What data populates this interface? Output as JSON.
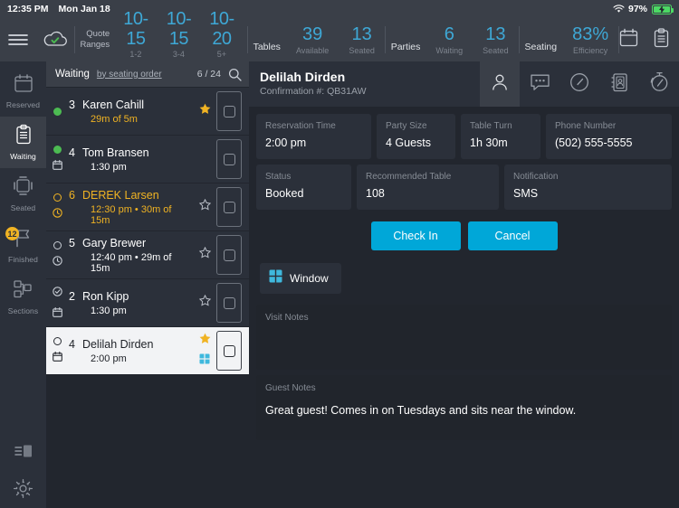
{
  "statusbar": {
    "time": "12:35 PM",
    "date": "Mon Jan 18",
    "battery": "97%",
    "wifi_icon": "wifi-icon",
    "battery_icon": "battery-charging-icon"
  },
  "topbar": {
    "menu_icon": "hamburger-menu-icon",
    "cloud_icon": "cloud-sync-icon",
    "quote": {
      "label_line1": "Quote",
      "label_line2": "Ranges",
      "cells": [
        {
          "value": "10-15",
          "label": "1-2 Parties"
        },
        {
          "value": "10-15",
          "label": "3-4 Parties"
        },
        {
          "value": "10-20",
          "label": "5+ Parties"
        }
      ]
    },
    "groups": [
      {
        "title": "Tables",
        "stats": [
          {
            "value": "39",
            "label": "Available"
          },
          {
            "value": "13",
            "label": "Seated"
          }
        ]
      },
      {
        "title": "Parties",
        "stats": [
          {
            "value": "6",
            "label": "Waiting"
          },
          {
            "value": "13",
            "label": "Seated"
          }
        ]
      },
      {
        "title": "Seating",
        "stats": [
          {
            "value": "83%",
            "label": "Efficiency"
          }
        ]
      }
    ],
    "right_icons": [
      "calendar-icon",
      "clipboard-icon"
    ]
  },
  "sidebar": {
    "items": [
      {
        "label": "Reserved",
        "icon": "calendar-icon",
        "active": false,
        "badge": null
      },
      {
        "label": "Waiting",
        "icon": "clipboard-icon",
        "active": true,
        "badge": null
      },
      {
        "label": "Seated",
        "icon": "table-icon",
        "active": false,
        "badge": null
      },
      {
        "label": "Finished",
        "icon": "flag-icon",
        "active": false,
        "badge": "12"
      },
      {
        "label": "Sections",
        "icon": "sections-icon",
        "active": false,
        "badge": null
      }
    ],
    "bottom_icons": [
      "layout-panel-icon",
      "gear-icon"
    ]
  },
  "list": {
    "title": "Waiting",
    "sort_label": "by seating order",
    "count": "6 / 24",
    "search_icon": "search-icon",
    "rows": [
      {
        "status_icon": "dot-green",
        "party_size": "3",
        "name": "Karen Cahill",
        "detail": "29m of 5m",
        "type_icon": null,
        "star": "star-filled",
        "amber": true,
        "selected": false,
        "window_icon": false
      },
      {
        "status_icon": "dot-green",
        "party_size": "4",
        "name": "Tom Bransen",
        "detail": "1:30 pm",
        "type_icon": "calendar-icon",
        "star": null,
        "amber": false,
        "selected": false,
        "window_icon": false
      },
      {
        "status_icon": "ring-amber",
        "party_size": "6",
        "name": "DEREK Larsen",
        "detail": "12:30 pm  •  30m of 15m",
        "type_icon": "clock-icon",
        "star": "star-outline",
        "amber": true,
        "selected": false,
        "window_icon": false
      },
      {
        "status_icon": "ring-white",
        "party_size": "5",
        "name": "Gary Brewer",
        "detail": "12:40 pm  •  29m of 15m",
        "type_icon": "clock-icon",
        "star": "star-outline",
        "amber": false,
        "selected": false,
        "window_icon": false
      },
      {
        "status_icon": "check-circle",
        "party_size": "2",
        "name": "Ron Kipp",
        "detail": "1:30 pm",
        "type_icon": "calendar-icon",
        "star": "star-outline",
        "amber": false,
        "selected": false,
        "window_icon": false
      },
      {
        "status_icon": "ring-white",
        "party_size": "4",
        "name": "Delilah Dirden",
        "detail": "2:00 pm",
        "type_icon": "calendar-icon",
        "star": "star-filled",
        "amber": false,
        "selected": true,
        "window_icon": true
      }
    ]
  },
  "detail": {
    "name": "Delilah Dirden",
    "confirmation": "Confirmation #: QB31AW",
    "tabs": [
      {
        "icon": "person-icon",
        "active": true
      },
      {
        "icon": "chat-icon",
        "active": false
      },
      {
        "icon": "clock-icon",
        "active": false
      },
      {
        "icon": "address-book-icon",
        "active": false
      },
      {
        "icon": "timer-icon",
        "active": false
      }
    ],
    "fields_row1": [
      {
        "key": "Reservation Time",
        "value": "2:00 pm"
      },
      {
        "key": "Party Size",
        "value": "4 Guests"
      },
      {
        "key": "Table Turn",
        "value": "1h 30m"
      },
      {
        "key": "Phone Number",
        "value": "(502) 555-5555"
      }
    ],
    "fields_row2": [
      {
        "key": "Status",
        "value": "Booked"
      },
      {
        "key": "Recommended Table",
        "value": "108"
      },
      {
        "key": "Notification",
        "value": "SMS"
      }
    ],
    "check_in_label": "Check In",
    "cancel_label": "Cancel",
    "tag": {
      "label": "Window",
      "icon": "window-icon"
    },
    "visit_notes": {
      "key": "Visit Notes",
      "value": ""
    },
    "guest_notes": {
      "key": "Guest Notes",
      "value": "Great guest! Comes in on Tuesdays and sits near the window."
    }
  },
  "colors": {
    "accent": "#00a7d8",
    "stat_blue": "#3ea8d6",
    "amber": "#f0b323",
    "green": "#4cbb52"
  }
}
